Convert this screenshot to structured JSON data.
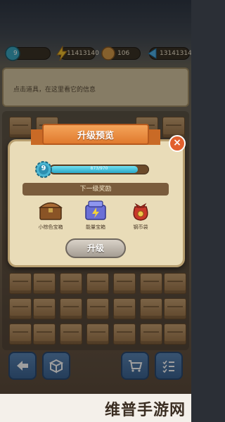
{
  "hud": {
    "level": "9",
    "energy": "11413140",
    "coins": "106",
    "gems": "13141314"
  },
  "info_bar": {
    "text": "点击道具，在这里看它的信息"
  },
  "modal": {
    "title": "升级预览",
    "close_label": "×",
    "level": "9",
    "progress_text": "873/970",
    "progress_fraction": 0.9,
    "rewards_header": "下一级奖励",
    "rewards": [
      {
        "label": "小棕色宝箱",
        "icon": "brown-chest-icon"
      },
      {
        "label": "能量宝箱",
        "icon": "energy-box-icon"
      },
      {
        "label": "钢币袋",
        "icon": "coin-bag-icon"
      }
    ],
    "upgrade_label": "升级"
  },
  "watermark": "维普手游网",
  "colors": {
    "ribbon": "#e07a2e",
    "panel": "#e9dcb8",
    "progress": "#2aa7c8",
    "bottom_button": "#3c6493"
  }
}
